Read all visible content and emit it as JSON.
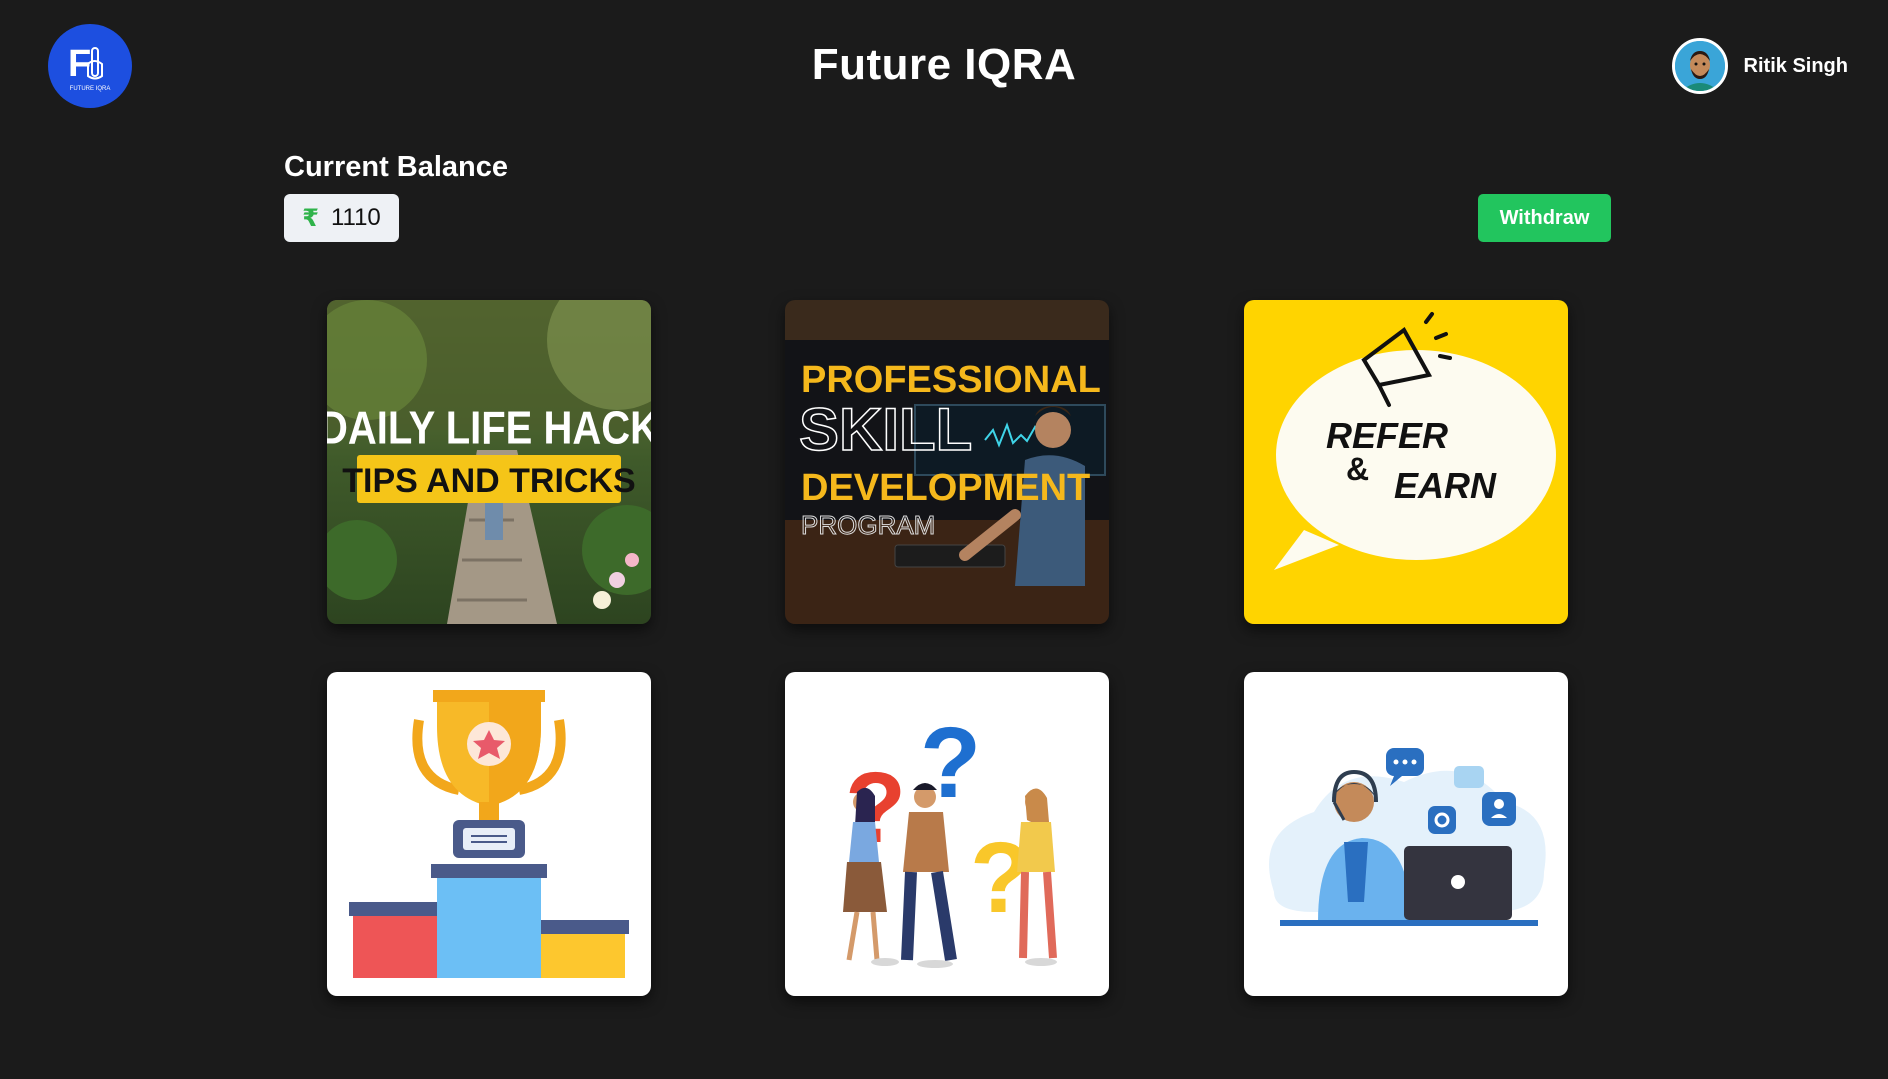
{
  "header": {
    "logo_text": "FUTURE IQRA",
    "title": "Future IQRA",
    "user_name": "Ritik Singh"
  },
  "balance": {
    "label": "Current Balance",
    "currency_symbol": "₹",
    "amount": "1110",
    "withdraw_label": "Withdraw"
  },
  "cards": [
    {
      "line1": "DAILY LIFE HACK",
      "line2": "TIPS AND TRICKS"
    },
    {
      "line1": "PROFESSIONAL",
      "line2": "SKILL",
      "line3": "DEVELOPMENT",
      "line4": "PROGRAM"
    },
    {
      "line1": "REFER",
      "line2": "&",
      "line3": "EARN"
    },
    {
      "icon": "trophy-podium"
    },
    {
      "icon": "question-people"
    },
    {
      "icon": "customer-support"
    }
  ],
  "colors": {
    "background": "#1b1b1b",
    "accent_green": "#22c55e",
    "logo_blue": "#1d4fe0",
    "refer_yellow": "#ffd400"
  }
}
